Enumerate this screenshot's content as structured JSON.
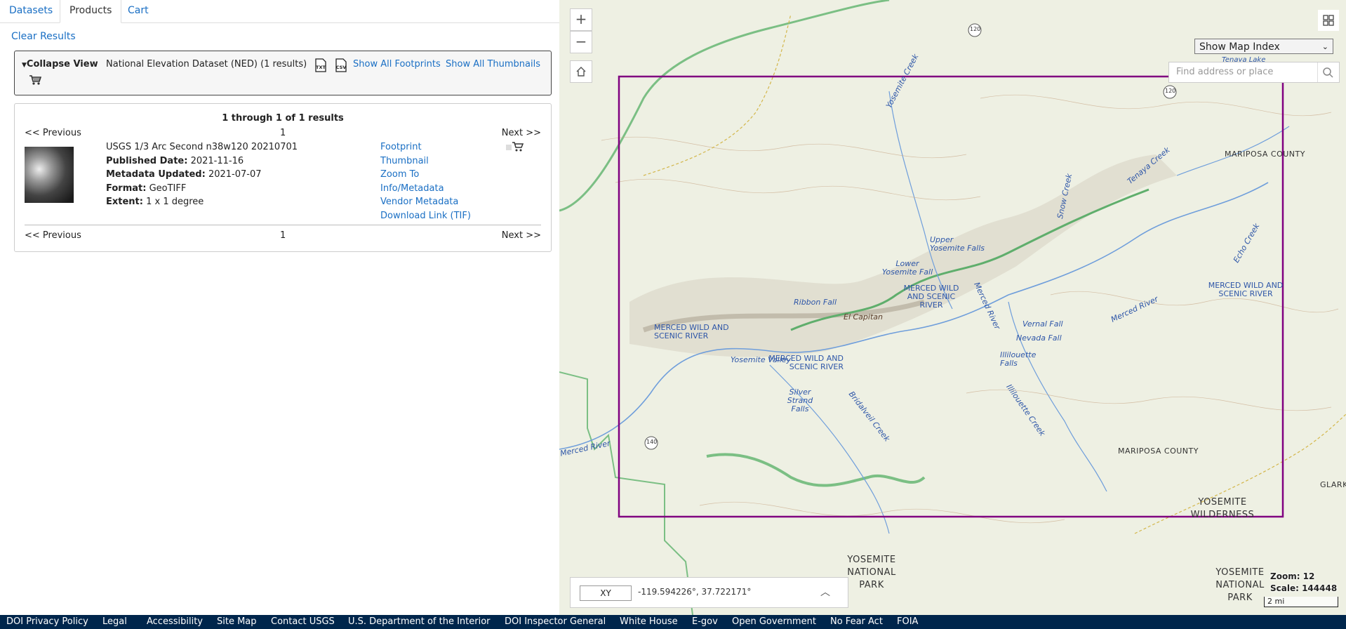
{
  "tabs": [
    {
      "label": "Datasets"
    },
    {
      "label": "Products"
    },
    {
      "label": "Cart"
    }
  ],
  "clear_results": "Clear Results",
  "dataset_group": {
    "collapse_label": "Collapse View",
    "title": "National Elevation Dataset (NED) (1 results)",
    "show_footprints": "Show All Footprints",
    "show_thumbnails": "Show All Thumbnails",
    "file_icons": [
      "txt-file-icon",
      "csv-file-icon"
    ]
  },
  "results": {
    "count_text": "1 through 1 of 1 results",
    "prev": "<< Previous",
    "next": "Next >>",
    "page": "1",
    "item": {
      "title": "USGS 1/3 Arc Second n38w120 20210701",
      "published_label": "Published Date:",
      "published": "2021-11-16",
      "metadata_label": "Metadata Updated:",
      "metadata": "2021-07-07",
      "format_label": "Format:",
      "format": "GeoTIFF",
      "extent_label": "Extent:",
      "extent": "1 x 1 degree",
      "links": [
        "Footprint",
        "Thumbnail",
        "Zoom To",
        "Info/Metadata",
        "Vendor Metadata",
        "Download Link (TIF)"
      ]
    }
  },
  "map": {
    "layer_select": "Show Map Index",
    "search_placeholder": "Find address or place",
    "coord_mode": "XY",
    "coords": "-119.594226°, 37.722171°",
    "zoom_text": "Zoom: 12",
    "scale_text": "Scale: 144448",
    "scale_bar": "2 mi",
    "footprint_color": "#800080",
    "labels": {
      "mariposa1": "MARIPOSA COUNTY",
      "mariposa2": "MARIPOSA COUNTY",
      "yosemite_creek": "Yosemite Creek",
      "snow_creek": "Snow Creek",
      "tenaya_creek": "Tenaya Creek",
      "echo_creek": "Echo Creek",
      "upper_falls": "Upper Yosemite Falls",
      "lower_falls": "Lower Yosemite Fall",
      "ribbon_fall": "Ribbon Fall",
      "el_capitan": "El Capitan",
      "vernal_fall": "Vernal Fall",
      "nevada_fall": "Nevada Fall",
      "illilouette_falls": "Illilouette Falls",
      "illilouette_creek": "Illilouette Creek",
      "bridalveil_creek": "Bridalveil Creek",
      "silver_strand": "Silver Strand Falls",
      "yosemite_valley": "Yosemite Valley",
      "merced_river1": "Merced River",
      "merced_river2": "Merced River",
      "merced_river3": "Merced River",
      "mwsr1": "MERCED WILD AND SCENIC RIVER",
      "mwsr2": "MERCED WILD AND SCENIC RIVER",
      "mwsr3": "MERCED WILD AND SCENIC RIVER",
      "mwsr4": "MERCED WILD AND SCENIC RIVER",
      "ynp": "YOSEMITE NATIONAL PARK",
      "ynp2": "YOSEMITE NATIONAL PARK",
      "wilderness": "YOSEMITE WILDERNESS",
      "glark": "GLARK",
      "tenaya_lake": "Tenaya Lake",
      "hwy120a": "120",
      "hwy120b": "120",
      "hwy140": "140"
    }
  },
  "footer": [
    "DOI Privacy Policy",
    "Legal",
    "Accessibility",
    "Site Map",
    "Contact USGS",
    "U.S. Department of the Interior",
    "DOI Inspector General",
    "White House",
    "E-gov",
    "Open Government",
    "No Fear Act",
    "FOIA"
  ]
}
